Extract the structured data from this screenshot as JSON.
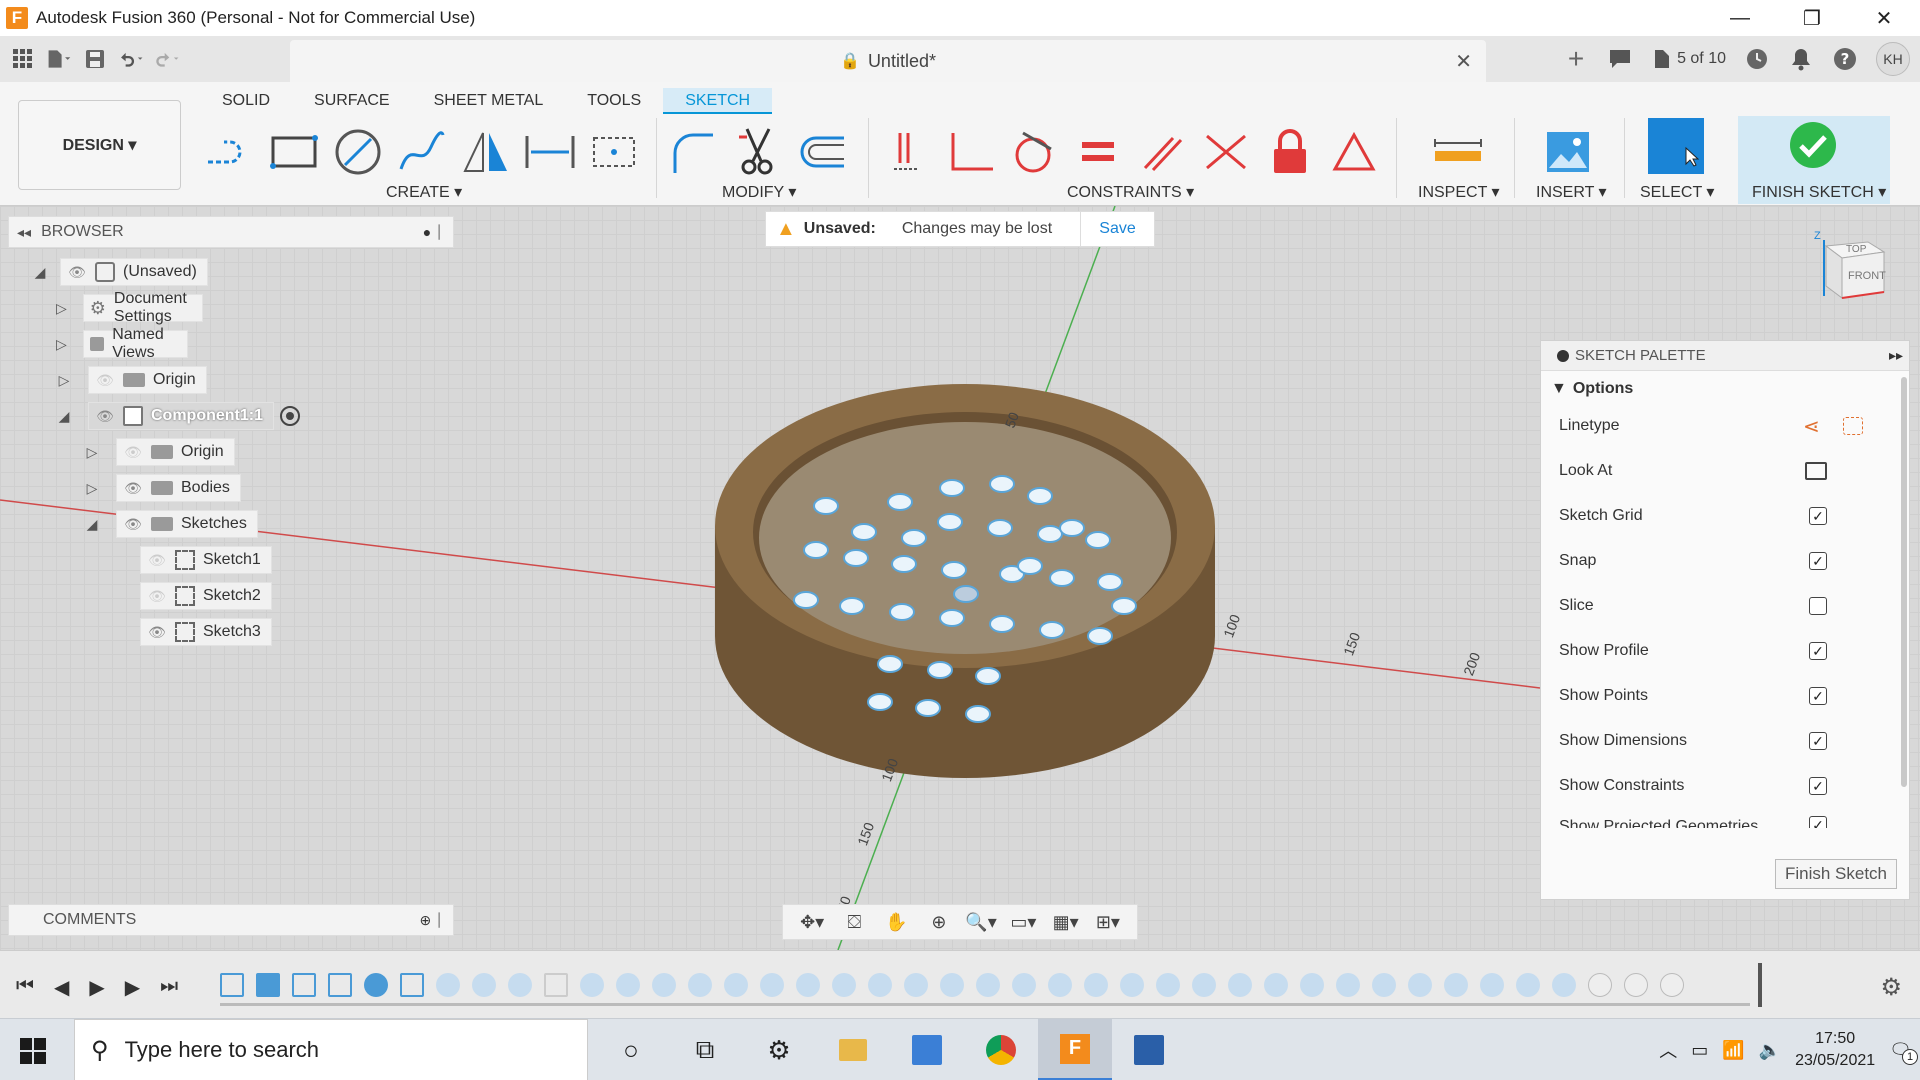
{
  "window": {
    "title": "Autodesk Fusion 360 (Personal - Not for Commercial Use)",
    "minimize": "—",
    "restore": "❐",
    "close": "✕"
  },
  "docbar": {
    "doc_name": "Untitled*",
    "jobs": "5 of 10",
    "user_initials": "KH"
  },
  "ribbon": {
    "workspace": "DESIGN ▾",
    "tabs": [
      "SOLID",
      "SURFACE",
      "SHEET METAL",
      "TOOLS",
      "SKETCH"
    ],
    "active_tab": "SKETCH",
    "groups": [
      "CREATE ▾",
      "MODIFY ▾",
      "CONSTRAINTS ▾",
      "INSPECT ▾",
      "INSERT ▾",
      "SELECT ▾",
      "FINISH SKETCH ▾"
    ]
  },
  "browser": {
    "header": "BROWSER",
    "nodes": [
      {
        "label": "(Unsaved)"
      },
      {
        "label": "Document Settings"
      },
      {
        "label": "Named Views"
      },
      {
        "label": "Origin"
      },
      {
        "label": "Component1:1"
      },
      {
        "label": "Origin"
      },
      {
        "label": "Bodies"
      },
      {
        "label": "Sketches"
      },
      {
        "label": "Sketch1"
      },
      {
        "label": "Sketch2"
      },
      {
        "label": "Sketch3"
      }
    ]
  },
  "unsaved_bar": {
    "title": "Unsaved:",
    "message": "Changes may be lost",
    "save_label": "Save"
  },
  "viewcube": {
    "top": "TOP",
    "front": "FRONT",
    "z": "Z"
  },
  "viewport": {
    "axis_labels": [
      "100",
      "150",
      "200",
      "100",
      "150",
      "50",
      "50"
    ]
  },
  "palette": {
    "header": "SKETCH PALETTE",
    "section": "Options",
    "rows": [
      {
        "label": "Linetype",
        "checked": null
      },
      {
        "label": "Look At",
        "checked": null
      },
      {
        "label": "Sketch Grid",
        "checked": true
      },
      {
        "label": "Snap",
        "checked": true
      },
      {
        "label": "Slice",
        "checked": false
      },
      {
        "label": "Show Profile",
        "checked": true
      },
      {
        "label": "Show Points",
        "checked": true
      },
      {
        "label": "Show Dimensions",
        "checked": true
      },
      {
        "label": "Show Constraints",
        "checked": true
      },
      {
        "label": "Show Projected Geometries",
        "checked": true
      }
    ],
    "finish_button": "Finish Sketch"
  },
  "comments": {
    "header": "COMMENTS"
  },
  "taskbar": {
    "search_placeholder": "Type here to search",
    "time": "17:50",
    "date": "23/05/2021",
    "notifications": "1"
  },
  "colors": {
    "accent": "#0696d7",
    "select_blue": "#1a84d6",
    "finish_green": "#2db84b",
    "constraint_red": "#e03a3a",
    "wood": "#7a5f3c"
  }
}
